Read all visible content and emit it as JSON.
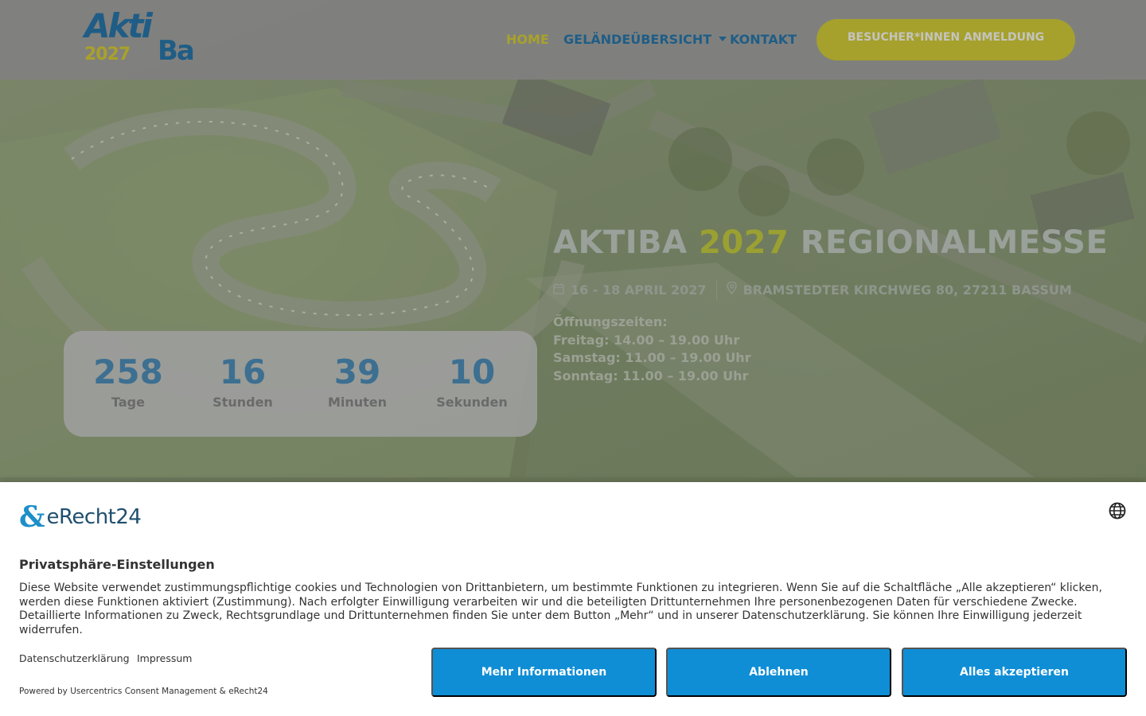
{
  "header": {
    "logo": {
      "line1": "Akti",
      "line2": "2027",
      "line3": "Ba"
    },
    "nav": [
      {
        "label": "Home"
      },
      {
        "label": "Geländeübersicht"
      },
      {
        "label": "Kontakt"
      }
    ],
    "cta_label": "Besucher*innen Anmeldung"
  },
  "hero": {
    "title_prefix": "AKTIBA ",
    "title_year": "2027",
    "title_suffix": " REGIONALMESSE",
    "date": "16 - 18 April 2027",
    "address": "Bramstedter Kirchweg 80, 27211 Bassum",
    "hours": [
      "Öffnungszeiten:",
      "Freitag: 14.00 – 19.00 Uhr",
      "Samstag: 11.00 – 19.00 Uhr",
      "Sonntag: 11.00 – 19.00 Uhr"
    ]
  },
  "countdown": [
    {
      "value": "258",
      "label": "Tage"
    },
    {
      "value": "16",
      "label": "Stunden"
    },
    {
      "value": "39",
      "label": "Minuten"
    },
    {
      "value": "10",
      "label": "Sekunden"
    }
  ],
  "consent": {
    "brand": "eRecht24",
    "title": "Privatsphäre-Einstellungen",
    "text": "Diese Website verwendet zustimmungspflichtige cookies und Technologien von Drittanbietern, um bestimmte Funktionen zu integrieren. Wenn Sie auf die Schaltfläche „Alle akzeptieren“ klicken, werden diese Funktionen aktiviert (Zustimmung). Nach erfolgter Einwilligung verarbeiten wir und die beteiligten Drittunternehmen Ihre personenbezogenen Daten für verschiedene Zwecke. Detaillierte Informationen zu Zweck, Rechtsgrundlage und Drittunternehmen finden Sie unter dem Button „Mehr“ und in unserer Datenschutzerklärung. Sie können Ihre Einwilligung jederzeit widerrufen.",
    "link_privacy": "Datenschutzerklärung",
    "link_imprint": "Impressum",
    "powered": "Powered by Usercentrics Consent Management & eRecht24",
    "btn_more": "Mehr Informationen",
    "btn_decline": "Ablehnen",
    "btn_accept": "Alles akzeptieren"
  },
  "colors": {
    "brand_blue": "#1f5d86",
    "brand_olive": "#a9a12b",
    "consent_button": "#0f8ed6"
  }
}
